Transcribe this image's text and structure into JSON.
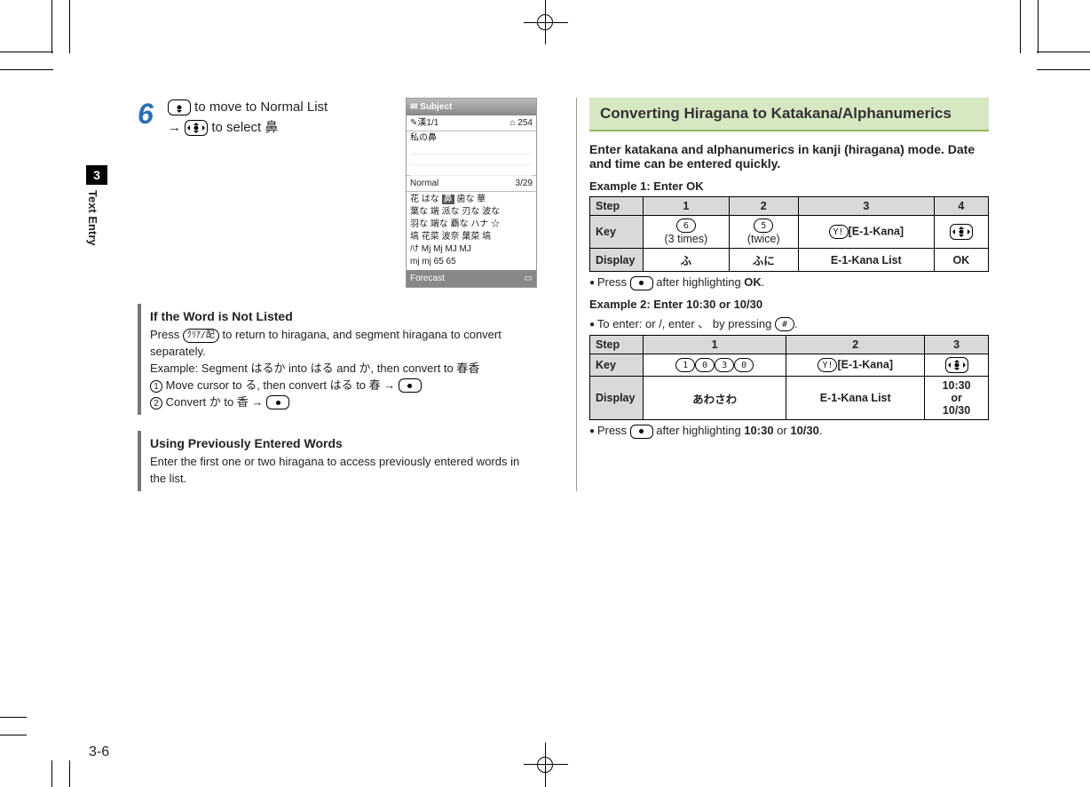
{
  "chapter": {
    "number": "3",
    "label": "Text Entry"
  },
  "page_number": "3-6",
  "left": {
    "step_number": "6",
    "step_line1_suffix": " to move to Normal List",
    "step_arrow": "→",
    "step_line2_suffix": " to select 鼻",
    "phone": {
      "title_left": "✉ Subject",
      "mode": "✎漢1/1",
      "count": "⌂ 254",
      "entered": "私の鼻",
      "normal_label": "Normal",
      "normal_count": "3/29",
      "cand_l1_a": "花  はな",
      "cand_l1_b": "鼻",
      "cand_l1_c": "歯な  華",
      "cand_l2": "葉な  端  派な  刃な  波な",
      "cand_l3": "羽な  端な  覇な  ハナ  ☆",
      "cand_l4": "塙  花菜  波奈  葉菜  塙",
      "cand_l5": "ﾊﾅ  Mj  Mj  MJ  MJ",
      "cand_l6": "mj  mj  65  65",
      "footer": "Forecast"
    },
    "note1": {
      "title": "If the Word is Not Listed",
      "l1a": "Press ",
      "l1b": " to return to hiragana, and segment hiragana to convert separately.",
      "l2": "Example: Segment はるか into はる and か, then convert to 春香",
      "s1a": " Move cursor to る, then convert はる to 春 ",
      "s2a": " Convert か to 香 ",
      "arrow": "→",
      "clear_key": "ｸﾘｱ/配"
    },
    "note2": {
      "title": "Using Previously Entered Words",
      "l1": "Enter the first one or two hiragana to access previously entered words in the list."
    }
  },
  "right": {
    "heading": "Converting Hiragana to Katakana/Alphanumerics",
    "lead": "Enter katakana and alphanumerics in kanji (hiragana) mode. Date and time can be entered quickly.",
    "ex1_title": "Example 1: Enter OK",
    "table1": {
      "steph": "Step",
      "c1": "1",
      "c2": "2",
      "c3": "3",
      "c4": "4",
      "keyh": "Key",
      "k1_key": "6",
      "k1_note": "(3 times)",
      "k2_key": "5",
      "k2_note": "(twice)",
      "k3_key": "Y!",
      "k3_label": "[E-1-Kana]",
      "disph": "Display",
      "d1": "ふ",
      "d2": "ふに",
      "d3": "E-1-Kana List",
      "d4": "OK"
    },
    "ex1_note_a": " Press ",
    "ex1_note_b": " after highlighting ",
    "ex1_note_c": "OK",
    "ex1_note_d": ".",
    "ex2_title": "Example 2: Enter 10:30 or 10/30",
    "ex2_bullet_a": " To enter: or /, enter 、 by pressing ",
    "ex2_bullet_key": "#",
    "ex2_bullet_b": ".",
    "table2": {
      "steph": "Step",
      "c1": "1",
      "c2": "2",
      "c3": "3",
      "keyh": "Key",
      "k1_1": "1",
      "k1_2": "0",
      "k1_3": "3",
      "k1_4": "0",
      "k2_key": "Y!",
      "k2_label": "[E-1-Kana]",
      "disph": "Display",
      "d1": "あわさわ",
      "d2": "E-1-Kana List",
      "d3a": "10:30",
      "d3b": "or",
      "d3c": "10/30"
    },
    "ex2_note_a": " Press ",
    "ex2_note_b": " after highlighting ",
    "ex2_note_c": "10:30",
    "ex2_note_d": " or ",
    "ex2_note_e": "10/30",
    "ex2_note_f": "."
  }
}
